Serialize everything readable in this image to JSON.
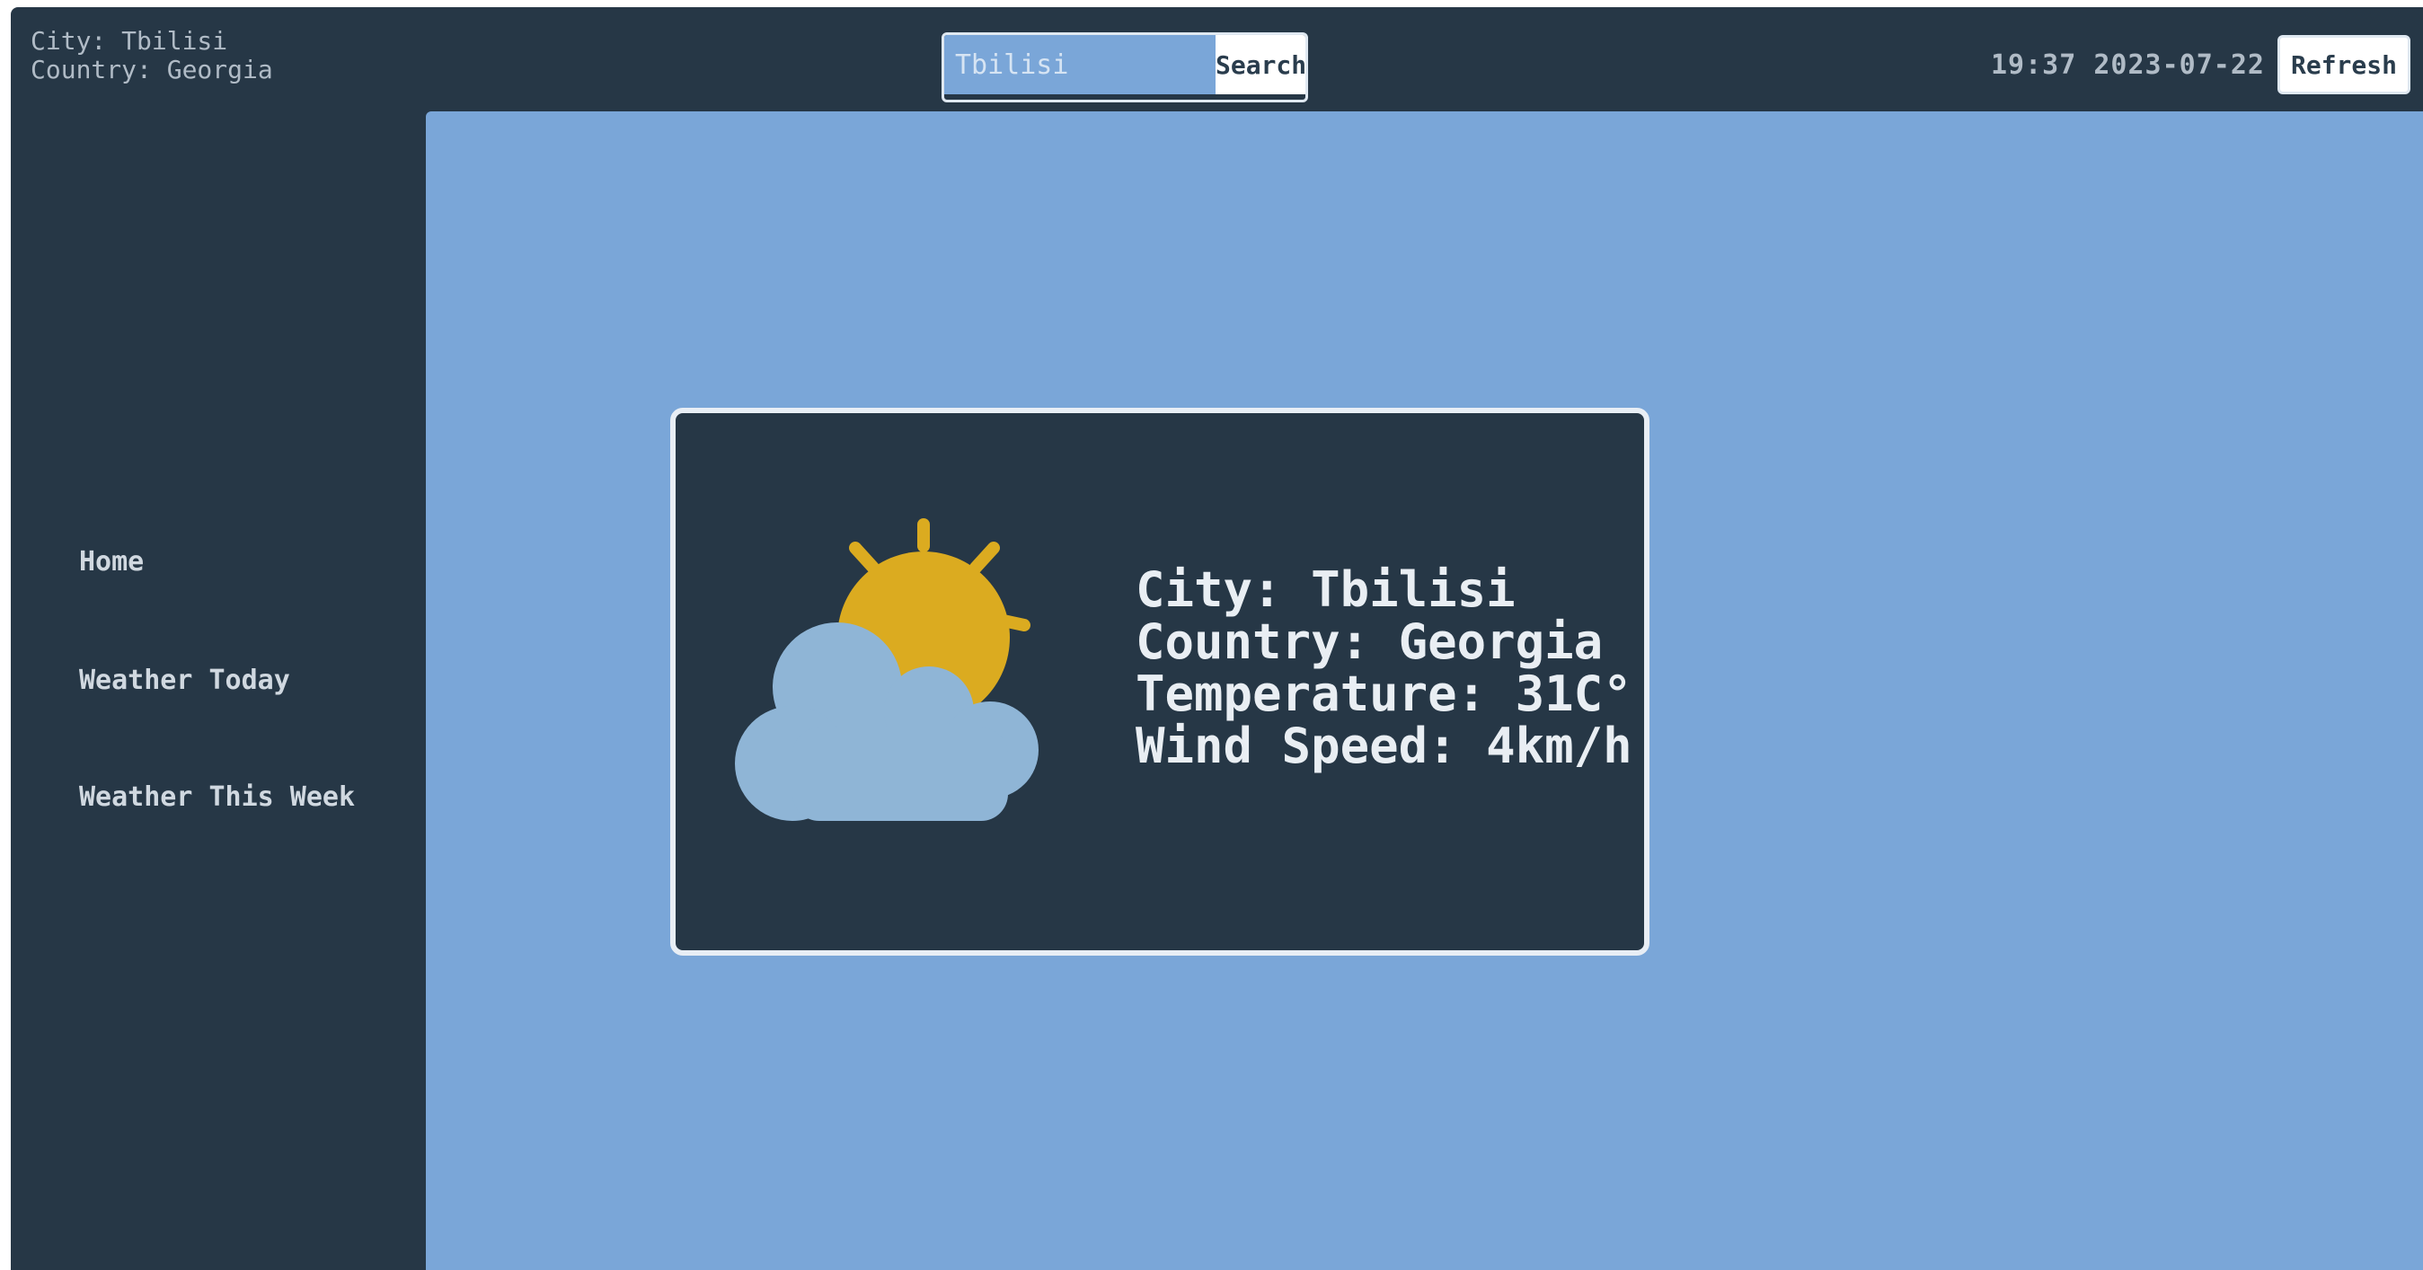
{
  "header": {
    "city_line": "City: Tbilisi",
    "country_line": "Country: Georgia",
    "search": {
      "placeholder": "Tbilisi",
      "button_label": "Search"
    },
    "datetime": "19:37 2023-07-22",
    "right_button_label": "Refresh"
  },
  "sidebar": {
    "items": [
      {
        "label": "Home"
      },
      {
        "label": "Weather Today"
      },
      {
        "label": "Weather This Week"
      }
    ]
  },
  "weather_card": {
    "icon": "partly-cloudy-icon",
    "lines": [
      "City: Tbilisi",
      "Country: Georgia",
      "Temperature: 31C°",
      "Wind Speed: 4km/h"
    ]
  },
  "colors": {
    "dark_panel": "#263746",
    "main_background": "#7aa6d8",
    "sun": "#dbab20",
    "cloud": "#8fb5d6"
  }
}
